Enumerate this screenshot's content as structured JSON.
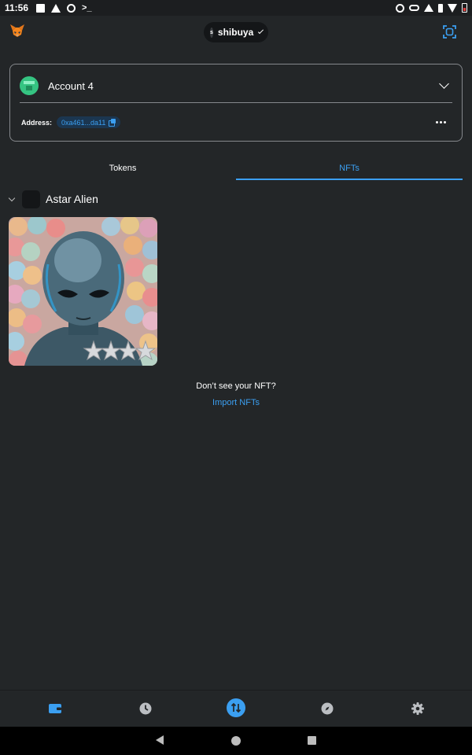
{
  "status_bar": {
    "time": "11:56",
    "left_icons": [
      "image-icon",
      "telegram-icon",
      "rocket-icon",
      "terminal-icon"
    ],
    "terminal_glyph": ">_",
    "right_icons": [
      "alarm-icon",
      "vpn-key-icon",
      "bluetooth-icon",
      "vibrate-icon",
      "wifi-icon",
      "battery-low-icon"
    ]
  },
  "header": {
    "logo_icon": "metamask-fox-icon",
    "network": {
      "initial": "s",
      "label": "shibuya"
    },
    "scan_icon": "scan-qr-icon"
  },
  "account": {
    "name": "Account 4",
    "address_label": "Address:",
    "address_value": "0xa461...da11"
  },
  "tabs": [
    {
      "label": "Tokens",
      "active": false
    },
    {
      "label": "NFTs",
      "active": true
    }
  ],
  "collection": {
    "name": "Astar Alien",
    "nft_image": "astar-alien-nft-image"
  },
  "empty_state": {
    "question": "Don’t see your NFT?",
    "link": "Import NFTs"
  },
  "bottom_tabs": [
    {
      "name": "wallet-icon",
      "active": true
    },
    {
      "name": "activity-clock-icon",
      "active": false
    },
    {
      "name": "swap-icon",
      "active": false
    },
    {
      "name": "browser-compass-icon",
      "active": false
    },
    {
      "name": "settings-gear-icon",
      "active": false
    }
  ],
  "colors": {
    "background": "#232628",
    "accent": "#3b9ff1",
    "border": "#85888c",
    "pill_dark": "#141618"
  }
}
